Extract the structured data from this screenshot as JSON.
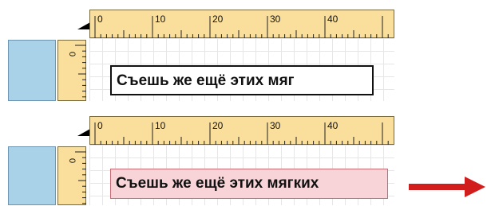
{
  "rulers": {
    "horizontal_labels": [
      "0",
      "10",
      "20",
      "30",
      "40"
    ],
    "vertical_label": "0"
  },
  "text_boxes": [
    {
      "text": "Съешь же ещё этих мяг",
      "state": "fits"
    },
    {
      "text": "Съешь же ещё этих мягких",
      "state": "overflow"
    }
  ],
  "colors": {
    "ruler": "#f9df9b",
    "block": "#a9d2e8",
    "overflow_fill": "#f8d4d8",
    "arrow": "#d21d1d"
  },
  "icons": {
    "arrow": "right-arrow-icon",
    "ruler_corner": "ruler-origin-triangle-icon"
  }
}
